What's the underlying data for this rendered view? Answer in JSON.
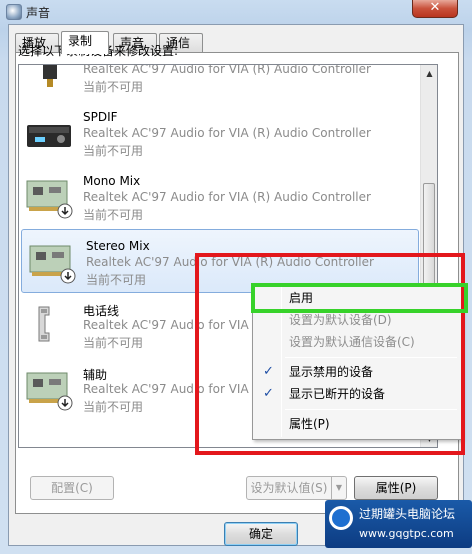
{
  "window": {
    "title": "声音",
    "close_glyph": "✕"
  },
  "tabs": [
    {
      "label": "播放",
      "active": false
    },
    {
      "label": "录制",
      "active": true
    },
    {
      "label": "声音",
      "active": false
    },
    {
      "label": "通信",
      "active": false
    }
  ],
  "instruction": "选择以下录制设备来修改设置:",
  "devices": [
    {
      "name": "",
      "description": "Realtek AC'97 Audio for VIA (R) Audio Controller",
      "status": "当前不可用",
      "icon": "audio-jack-icon"
    },
    {
      "name": "SPDIF",
      "description": "Realtek AC'97 Audio for VIA (R) Audio Controller",
      "status": "当前不可用",
      "icon": "spdif-device-icon"
    },
    {
      "name": "Mono Mix",
      "description": "Realtek AC'97 Audio for VIA (R) Audio Controller",
      "status": "当前不可用",
      "icon": "sound-card-icon"
    },
    {
      "name": "Stereo Mix",
      "description": "Realtek AC'97 Audio for VIA (R) Audio Controller",
      "status": "当前不可用",
      "icon": "sound-card-icon",
      "selected": true
    },
    {
      "name": "电话线",
      "description": "Realtek AC'97 Audio for VIA (R) Audio Controller",
      "status": "当前不可用",
      "icon": "telephone-handset-icon"
    },
    {
      "name": "辅助",
      "description": "Realtek AC'97 Audio for VIA (R) Audio Controller",
      "status": "当前不可用",
      "icon": "sound-card-icon"
    }
  ],
  "context_menu": {
    "items": [
      {
        "label": "启用",
        "enabled": true,
        "checked": false
      },
      {
        "label": "设置为默认设备(D)",
        "enabled": false,
        "checked": false
      },
      {
        "label": "设置为默认通信设备(C)",
        "enabled": false,
        "checked": false
      },
      {
        "label": "显示禁用的设备",
        "enabled": true,
        "checked": true
      },
      {
        "label": "显示已断开的设备",
        "enabled": true,
        "checked": true
      },
      {
        "label": "属性(P)",
        "enabled": true,
        "checked": false
      }
    ],
    "check_glyph": "✓"
  },
  "buttons": {
    "configure": "配置(C)",
    "set_default": "设为默认值(S)",
    "properties": "属性(P)",
    "ok": "确定"
  },
  "watermark": {
    "line1": "过期罐头电脑论坛",
    "line2": "www.gqgtpc.com"
  },
  "colors": {
    "highlight_red": "#e3171c",
    "highlight_green": "#37d22a",
    "selection_border": "#84acdd"
  }
}
